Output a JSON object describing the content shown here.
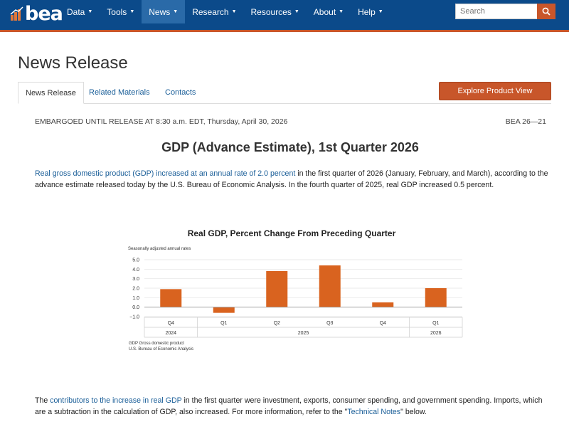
{
  "nav": {
    "logo_text": "bea",
    "items": [
      {
        "label": "Data",
        "active": false
      },
      {
        "label": "Tools",
        "active": false
      },
      {
        "label": "News",
        "active": true
      },
      {
        "label": "Research",
        "active": false
      },
      {
        "label": "Resources",
        "active": false
      },
      {
        "label": "About",
        "active": false
      },
      {
        "label": "Help",
        "active": false
      }
    ],
    "search_placeholder": "Search"
  },
  "page": {
    "title": "News Release",
    "tabs": [
      "News Release",
      "Related Materials",
      "Contacts"
    ],
    "explore_button": "Explore Product View"
  },
  "release": {
    "embargo": "EMBARGOED UNTIL RELEASE AT 8:30 a.m. EDT, Thursday, April 30, 2026",
    "number": "BEA 26—21",
    "title": "GDP (Advance Estimate), 1st Quarter 2026",
    "p1_link1": "Real gross domestic product",
    "p1_link2": "(GDP) increased at an annual rate of 2.0 percent",
    "p1_rest": " in the first quarter of 2026 (January, February, and March), according to the advance estimate released today by the U.S. Bureau of Economic Analysis. In the fourth quarter of 2025, real GDP increased 0.5 percent.",
    "p2_pre": "The ",
    "p2_link1": "contributors to the increase in real GDP",
    "p2_mid": " in the first quarter were investment, exports, consumer spending, and government spending. Imports, which are a subtraction in the calculation of GDP, also increased. For more information, refer to the \"",
    "p2_link2": "Technical Notes",
    "p2_end": "\" below."
  },
  "colors": {
    "nav_bg": "#0b4a8a",
    "accent": "#c8562a",
    "bar": "#d9631f",
    "link": "#1a5e98"
  },
  "chart_data": {
    "type": "bar",
    "title": "Real GDP, Percent Change From Preceding Quarter",
    "subtitle": "Seasonally adjusted annual rates",
    "categories": [
      "Q4",
      "Q1",
      "Q2",
      "Q3",
      "Q4",
      "Q1"
    ],
    "years": [
      {
        "label": "2024",
        "span": 1
      },
      {
        "label": "2025",
        "span": 4
      },
      {
        "label": "2026",
        "span": 1
      }
    ],
    "values": [
      1.9,
      -0.6,
      3.8,
      4.4,
      0.5,
      2.0
    ],
    "yticks": [
      "5.0",
      "4.0",
      "3.0",
      "2.0",
      "1.0",
      "0.0",
      "−1.0"
    ],
    "ylim": [
      -1.0,
      5.0
    ],
    "source_lines": [
      "GDP Gross domestic product",
      "U.S. Bureau of Economic Analysis"
    ]
  }
}
